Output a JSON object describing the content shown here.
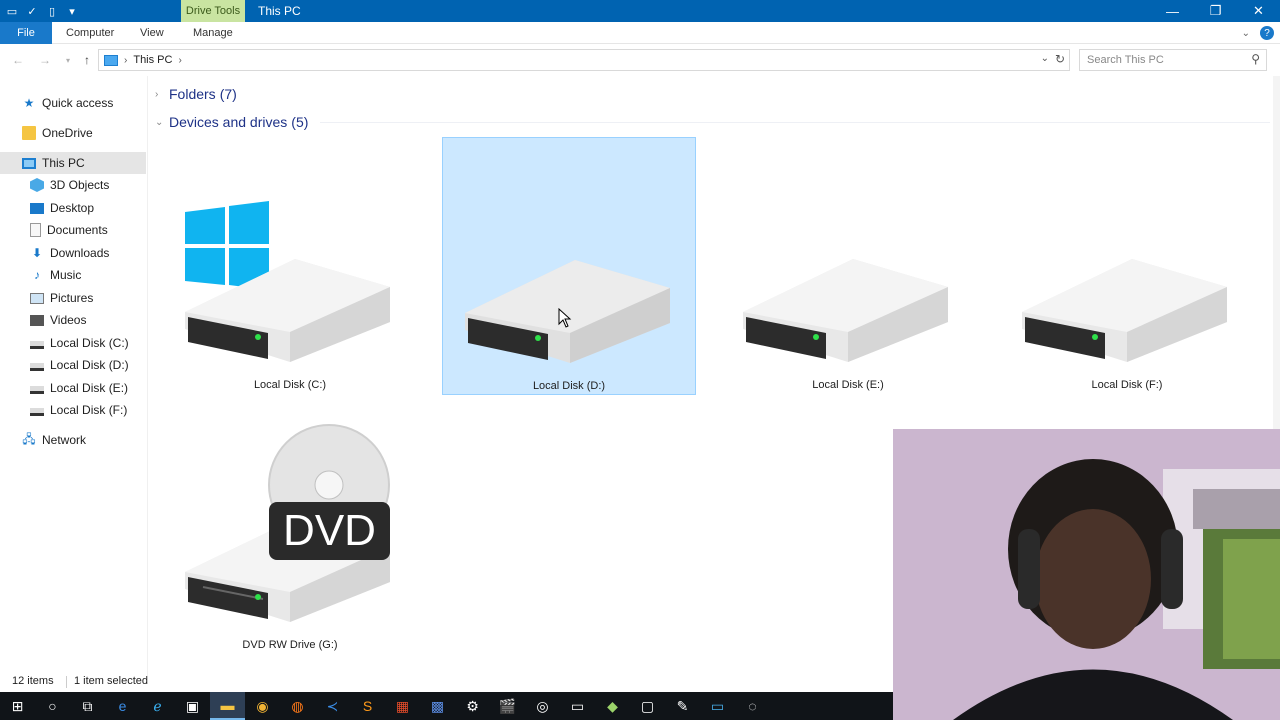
{
  "titlebar": {
    "context_tab": "Drive Tools",
    "title": "This PC",
    "qat_icons": [
      "app-icon",
      "properties-icon",
      "new-folder-icon",
      "customize-qat-icon"
    ],
    "window_buttons": [
      "minimize-icon",
      "restore-icon",
      "close-icon"
    ],
    "accent": "#0063b1",
    "context_tab_color": "#c9e4a1"
  },
  "ribbon": {
    "tabs": [
      "File",
      "Computer",
      "View",
      "Manage"
    ],
    "file_color": "#1979ca"
  },
  "navigation": {
    "back": "back-icon",
    "forward": "forward-icon",
    "recent": "recent-locations-icon",
    "up": "up-icon"
  },
  "address": {
    "crumbs": [
      "This PC"
    ]
  },
  "search": {
    "placeholder": "Search This PC"
  },
  "sidebar": {
    "items": [
      {
        "label": "Quick access",
        "icon": "star-icon"
      },
      {
        "label": "OneDrive",
        "icon": "onedrive-folder-icon"
      },
      {
        "label": "This PC",
        "icon": "this-pc-icon",
        "selected": true
      },
      {
        "label": "3D Objects",
        "icon": "3d-objects-icon"
      },
      {
        "label": "Desktop",
        "icon": "desktop-icon"
      },
      {
        "label": "Documents",
        "icon": "documents-icon"
      },
      {
        "label": "Downloads",
        "icon": "downloads-icon"
      },
      {
        "label": "Music",
        "icon": "music-icon"
      },
      {
        "label": "Pictures",
        "icon": "pictures-icon"
      },
      {
        "label": "Videos",
        "icon": "videos-icon"
      },
      {
        "label": "Local Disk (C:)",
        "icon": "disk-icon"
      },
      {
        "label": "Local Disk (D:)",
        "icon": "disk-icon"
      },
      {
        "label": "Local Disk (E:)",
        "icon": "disk-icon"
      },
      {
        "label": "Local Disk (F:)",
        "icon": "disk-icon"
      },
      {
        "label": "Network",
        "icon": "network-icon"
      }
    ]
  },
  "main": {
    "groups": [
      {
        "name": "Folders",
        "count": "(7)",
        "expanded": false
      },
      {
        "name": "Devices and drives",
        "count": "(5)",
        "expanded": true
      }
    ],
    "drives": [
      {
        "label": "Local Disk (C:)",
        "icon": "system-drive-icon",
        "selected": false
      },
      {
        "label": "Local Disk (D:)",
        "icon": "hard-drive-icon",
        "selected": true
      },
      {
        "label": "Local Disk (E:)",
        "icon": "hard-drive-icon",
        "selected": false
      },
      {
        "label": "Local Disk (F:)",
        "icon": "hard-drive-icon",
        "selected": false
      },
      {
        "label": "DVD RW Drive (G:)",
        "icon": "dvd-drive-icon",
        "selected": false
      }
    ],
    "dvd_badge": "DVD",
    "selection_color": "#cce8ff"
  },
  "status": {
    "items": "12 items",
    "selected": "1 item selected"
  },
  "taskbar": {
    "items": [
      "start-icon",
      "cortana-icon",
      "task-view-icon",
      "edge-icon",
      "ie-icon",
      "store-icon",
      "file-explorer-icon",
      "chrome-icon",
      "firefox-icon",
      "vscode-icon",
      "sublime-icon",
      "office-icon",
      "app-grid-icon",
      "settings-icon",
      "clapper-icon",
      "media-icon",
      "cmd-icon",
      "git-icon",
      "remote-icon",
      "paint-icon",
      "display-icon",
      "obs-icon"
    ],
    "active": "file-explorer-icon"
  },
  "overlay": {
    "webcam": "webcam-feed"
  }
}
